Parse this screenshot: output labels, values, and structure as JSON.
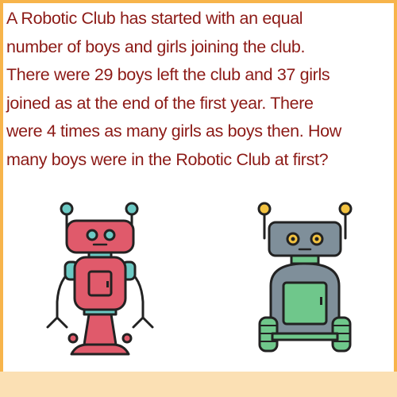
{
  "question": {
    "lines": [
      "A Robotic Club has started with an equal",
      "number of boys and girls joining the club.",
      "There were 29 boys left the club and 37 girls",
      "joined as at the end of the first year. There",
      "were 4 times as many girls as boys then. How",
      "many boys were in the Robotic Club at first?"
    ]
  },
  "colors": {
    "frame": "#f7b44b",
    "text": "#8c1a16",
    "bottom_band": "#fbe0b4"
  },
  "illustrations": {
    "left": "pink-robot-icon",
    "right": "gray-robot-icon"
  }
}
